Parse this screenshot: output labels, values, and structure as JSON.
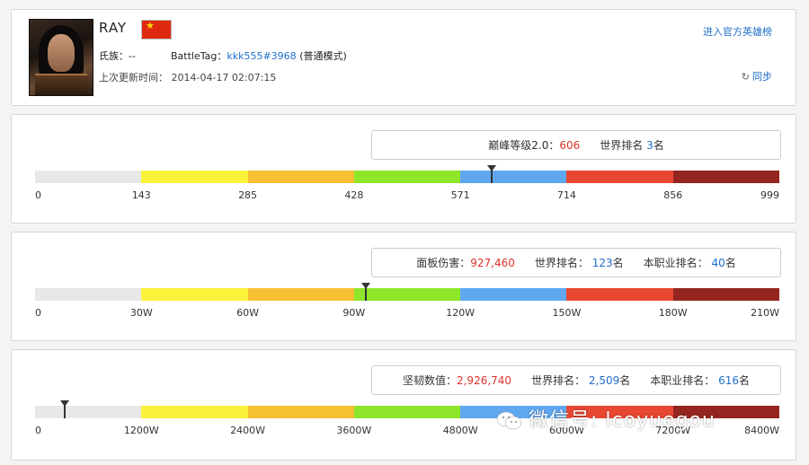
{
  "profile": {
    "name": "RAY",
    "clan_label": "氏族：--",
    "battletag_label": "BattleTag：",
    "battletag_value": "kkk555#3968",
    "mode": "(普通模式)",
    "last_update": "上次更新时间： 2014-04-17 02:07:15",
    "official_link": "进入官方英雄榜",
    "sync_label": "同步"
  },
  "stats": [
    {
      "items": [
        {
          "label": "巅峰等级2.0：",
          "value": "606",
          "suffix": "",
          "color": "red"
        },
        {
          "label": "世界排名 ",
          "value": "3",
          "suffix": "名",
          "color": "blue"
        }
      ],
      "ticks": [
        "0",
        "143",
        "285",
        "428",
        "571",
        "714",
        "856",
        "999"
      ],
      "marker_fraction": 0.613
    },
    {
      "items": [
        {
          "label": "面板伤害：",
          "value": "927,460",
          "suffix": "",
          "color": "red"
        },
        {
          "label": "世界排名： ",
          "value": "123",
          "suffix": "名",
          "color": "blue"
        },
        {
          "label": "本职业排名： ",
          "value": "40",
          "suffix": "名",
          "color": "blue"
        }
      ],
      "ticks": [
        "0",
        "30W",
        "60W",
        "90W",
        "120W",
        "150W",
        "180W",
        "210W"
      ],
      "marker_fraction": 0.445
    },
    {
      "items": [
        {
          "label": "坚韧数值：",
          "value": "2,926,740",
          "suffix": "",
          "color": "red"
        },
        {
          "label": "世界排名： ",
          "value": "2,509",
          "suffix": "名",
          "color": "blue"
        },
        {
          "label": "本职业排名： ",
          "value": "616",
          "suffix": "名",
          "color": "blue"
        }
      ],
      "ticks": [
        "0",
        "1200W",
        "2400W",
        "3600W",
        "4800W",
        "6000W",
        "7200W",
        "8400W"
      ],
      "marker_fraction": 0.04
    }
  ],
  "watermark": "微信号: lcoyuegou",
  "colors": {
    "link": "#1f6ec9",
    "value_red": "#d9342b",
    "segments": [
      "#e8e8e8",
      "#f9f23b",
      "#f6c032",
      "#8ee62a",
      "#5fa8f0",
      "#e84732",
      "#94261f"
    ]
  }
}
